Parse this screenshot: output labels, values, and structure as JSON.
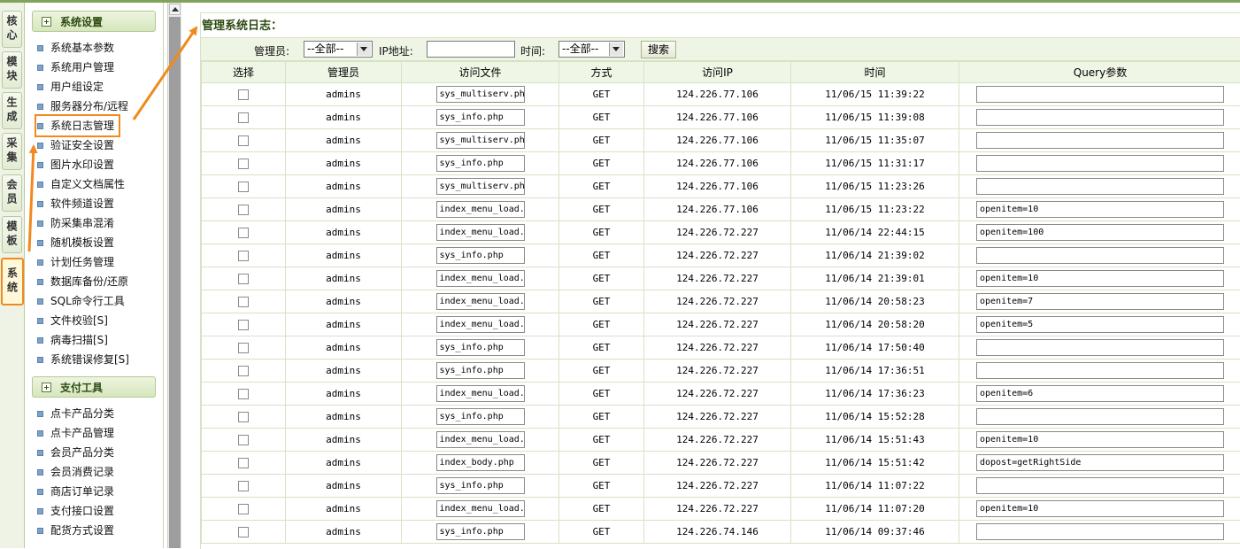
{
  "vtabs": [
    "核心",
    "模块",
    "生成",
    "采集",
    "会员",
    "模板",
    "系统"
  ],
  "menu": {
    "group1": "系统设置",
    "items1": [
      "系统基本参数",
      "系统用户管理",
      "用户组设定",
      "服务器分布/远程",
      "系统日志管理",
      "验证安全设置",
      "图片水印设置",
      "自定义文档属性",
      "软件频道设置",
      "防采集串混淆",
      "随机模板设置",
      "计划任务管理",
      "数据库备份/还原",
      "SQL命令行工具",
      "文件校验[S]",
      "病毒扫描[S]",
      "系统错误修复[S]"
    ],
    "group2": "支付工具",
    "items2": [
      "点卡产品分类",
      "点卡产品管理",
      "会员产品分类",
      "会员消费记录",
      "商店订单记录",
      "支付接口设置",
      "配货方式设置"
    ]
  },
  "main": {
    "title": "管理系统日志：",
    "filter": {
      "admin_label": "管理员:",
      "admin_value": "--全部--",
      "ip_label": "IP地址:",
      "ip_value": "",
      "time_label": "时间:",
      "time_value": "--全部--",
      "search_label": "搜索"
    },
    "columns": [
      "选择",
      "管理员",
      "访问文件",
      "方式",
      "访问IP",
      "时间",
      "Query参数"
    ],
    "rows": [
      {
        "admin": "admins",
        "file": "sys_multiserv.php",
        "method": "GET",
        "ip": "124.226.77.106",
        "time": "11/06/15 11:39:22",
        "query": ""
      },
      {
        "admin": "admins",
        "file": "sys_info.php",
        "method": "GET",
        "ip": "124.226.77.106",
        "time": "11/06/15 11:39:08",
        "query": ""
      },
      {
        "admin": "admins",
        "file": "sys_multiserv.php",
        "method": "GET",
        "ip": "124.226.77.106",
        "time": "11/06/15 11:35:07",
        "query": ""
      },
      {
        "admin": "admins",
        "file": "sys_info.php",
        "method": "GET",
        "ip": "124.226.77.106",
        "time": "11/06/15 11:31:17",
        "query": ""
      },
      {
        "admin": "admins",
        "file": "sys_multiserv.php",
        "method": "GET",
        "ip": "124.226.77.106",
        "time": "11/06/15 11:23:26",
        "query": ""
      },
      {
        "admin": "admins",
        "file": "index_menu_load.php",
        "method": "GET",
        "ip": "124.226.77.106",
        "time": "11/06/15 11:23:22",
        "query": "openitem=10"
      },
      {
        "admin": "admins",
        "file": "index_menu_load.php",
        "method": "GET",
        "ip": "124.226.72.227",
        "time": "11/06/14 22:44:15",
        "query": "openitem=100"
      },
      {
        "admin": "admins",
        "file": "sys_info.php",
        "method": "GET",
        "ip": "124.226.72.227",
        "time": "11/06/14 21:39:02",
        "query": ""
      },
      {
        "admin": "admins",
        "file": "index_menu_load.php",
        "method": "GET",
        "ip": "124.226.72.227",
        "time": "11/06/14 21:39:01",
        "query": "openitem=10"
      },
      {
        "admin": "admins",
        "file": "index_menu_load.php",
        "method": "GET",
        "ip": "124.226.72.227",
        "time": "11/06/14 20:58:23",
        "query": "openitem=7"
      },
      {
        "admin": "admins",
        "file": "index_menu_load.php",
        "method": "GET",
        "ip": "124.226.72.227",
        "time": "11/06/14 20:58:20",
        "query": "openitem=5"
      },
      {
        "admin": "admins",
        "file": "sys_info.php",
        "method": "GET",
        "ip": "124.226.72.227",
        "time": "11/06/14 17:50:40",
        "query": ""
      },
      {
        "admin": "admins",
        "file": "sys_info.php",
        "method": "GET",
        "ip": "124.226.72.227",
        "time": "11/06/14 17:36:51",
        "query": ""
      },
      {
        "admin": "admins",
        "file": "index_menu_load.php",
        "method": "GET",
        "ip": "124.226.72.227",
        "time": "11/06/14 17:36:23",
        "query": "openitem=6"
      },
      {
        "admin": "admins",
        "file": "sys_info.php",
        "method": "GET",
        "ip": "124.226.72.227",
        "time": "11/06/14 15:52:28",
        "query": ""
      },
      {
        "admin": "admins",
        "file": "index_menu_load.php",
        "method": "GET",
        "ip": "124.226.72.227",
        "time": "11/06/14 15:51:43",
        "query": "openitem=10"
      },
      {
        "admin": "admins",
        "file": "index_body.php",
        "method": "GET",
        "ip": "124.226.72.227",
        "time": "11/06/14 15:51:42",
        "query": "dopost=getRightSide"
      },
      {
        "admin": "admins",
        "file": "sys_info.php",
        "method": "GET",
        "ip": "124.226.72.227",
        "time": "11/06/14 11:07:22",
        "query": ""
      },
      {
        "admin": "admins",
        "file": "index_menu_load.php",
        "method": "GET",
        "ip": "124.226.72.227",
        "time": "11/06/14 11:07:20",
        "query": "openitem=10"
      },
      {
        "admin": "admins",
        "file": "sys_info.php",
        "method": "GET",
        "ip": "124.226.74.146",
        "time": "11/06/14 09:37:46",
        "query": ""
      }
    ]
  },
  "colors": {
    "accent": "#f08a1c",
    "header_bg": "#eef5e4",
    "border": "#d6e2c4",
    "title": "#2d4a12"
  }
}
